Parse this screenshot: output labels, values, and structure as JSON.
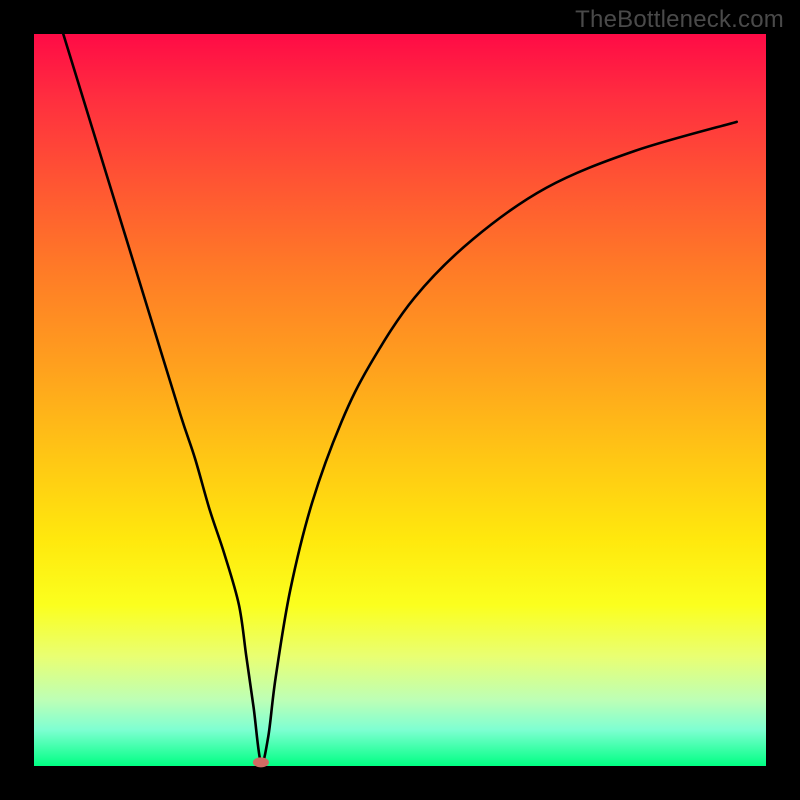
{
  "watermark": "TheBottleneck.com",
  "chart_data": {
    "type": "line",
    "title": "",
    "xlabel": "",
    "ylabel": "",
    "xlim": [
      0,
      100
    ],
    "ylim": [
      0,
      100
    ],
    "grid": false,
    "legend": false,
    "series": [
      {
        "name": "bottleneck-curve",
        "color": "#000000",
        "x": [
          4,
          8,
          12,
          16,
          20,
          22,
          24,
          26,
          28,
          29,
          30,
          31,
          32,
          33,
          35,
          38,
          42,
          46,
          52,
          60,
          70,
          82,
          96
        ],
        "y": [
          100,
          87,
          74,
          61,
          48,
          42,
          35,
          29,
          22,
          15,
          8,
          0.5,
          4,
          12,
          24,
          36,
          47,
          55,
          64,
          72,
          79,
          84,
          88
        ]
      }
    ],
    "marker": {
      "name": "optimum-point",
      "x": 31,
      "y": 0.5,
      "color": "#d06a63"
    }
  }
}
